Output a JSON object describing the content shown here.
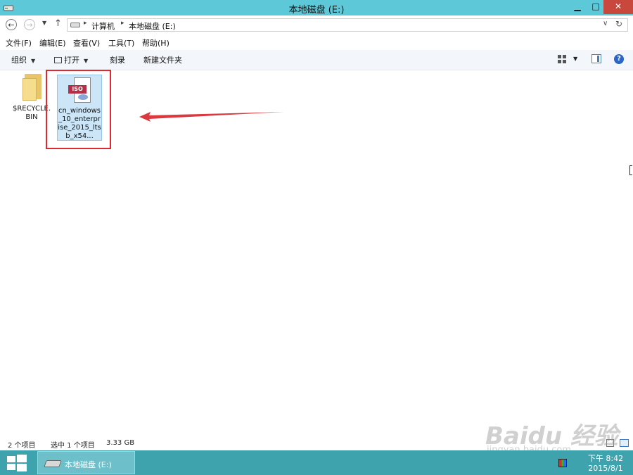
{
  "window": {
    "title": "本地磁盘 (E:)",
    "min_glyph": "▁",
    "max_glyph": "□",
    "close_glyph": "✕"
  },
  "address_bar": {
    "back_glyph": "←",
    "forward_glyph": "→",
    "recent_glyph": "▼",
    "up_glyph": "↑",
    "crumb_sep": "▸",
    "crumbs": [
      "计算机",
      "本地磁盘 (E:)"
    ],
    "dropdown_glyph": "∨",
    "refresh_glyph": "↻"
  },
  "menu": [
    "文件(F)",
    "编辑(E)",
    "查看(V)",
    "工具(T)",
    "帮助(H)"
  ],
  "toolbar": {
    "organize": "组织",
    "open": "打开",
    "burn": "刻录",
    "new_folder": "新建文件夹",
    "caret": "▼"
  },
  "files": [
    {
      "name": "$RECYCLE.BIN",
      "icon": "folder-icon"
    },
    {
      "name": "cn_windows_10_enterprise_2015_ltsb_x54...",
      "icon": "iso-file-icon",
      "tag": "ISO",
      "selected": true
    }
  ],
  "status": {
    "count": "2 个项目",
    "selected": "选中 1 个项目",
    "size": "3.33 GB"
  },
  "taskbar": {
    "item_label": "本地磁盘 (E:)",
    "time": "下午 8:42",
    "date": "2015/8/1"
  },
  "watermark": {
    "brand": "Baidu 经验",
    "url": "jingyan.baidu.com"
  },
  "colors": {
    "title_bar": "#5dc8d8",
    "taskbar": "#3fa3ae",
    "highlight_box": "#e0282f",
    "selection": "#cce6f7"
  }
}
